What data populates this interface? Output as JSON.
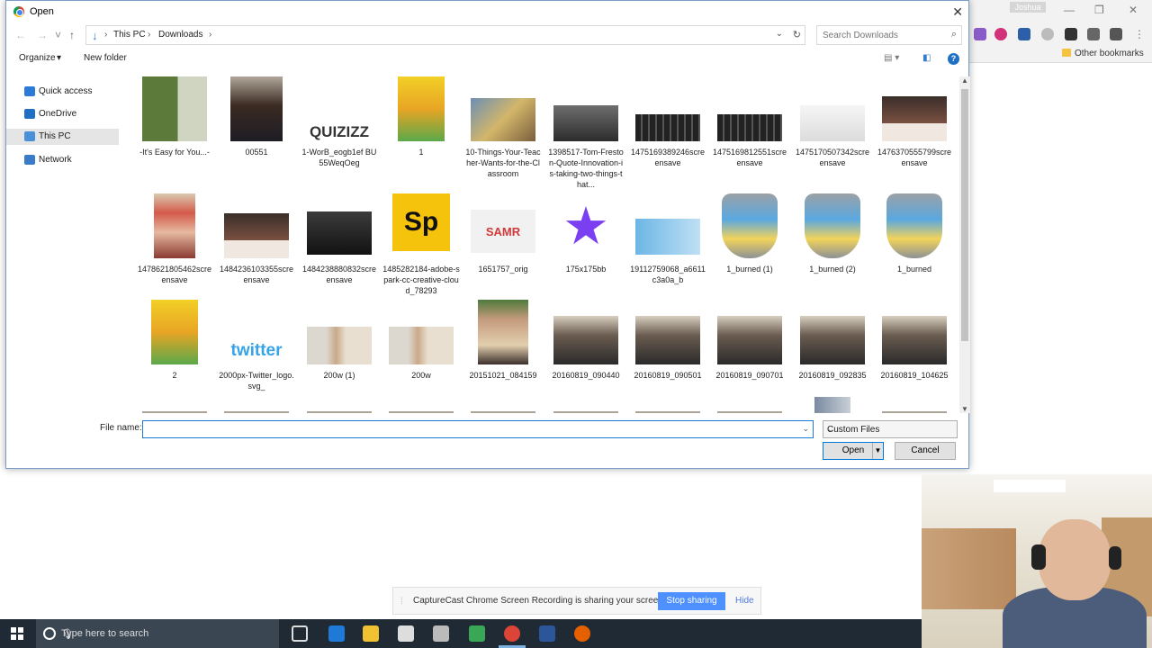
{
  "dialog": {
    "title": "Open",
    "close_glyph": "✕",
    "breadcrumbs": [
      "This PC",
      "Downloads"
    ],
    "search_placeholder": "Search Downloads",
    "commands": {
      "organize": "Organize",
      "organize_arrow": "▾",
      "new_folder": "New folder"
    },
    "help_glyph": "?",
    "nav": [
      {
        "label": "Quick access",
        "icon": "star-icon",
        "color": "#2d7ad6"
      },
      {
        "label": "OneDrive",
        "icon": "cloud-icon",
        "color": "#1f6fc5"
      },
      {
        "label": "This PC",
        "icon": "computer-icon",
        "color": "#4a90d9",
        "selected": true
      },
      {
        "label": "Network",
        "icon": "network-icon",
        "color": "#3a7bc8"
      }
    ],
    "files": [
      {
        "name": "-It's Easy for You...-",
        "thumb": "green-slide"
      },
      {
        "name": "00551",
        "thumb": "portrait"
      },
      {
        "name": "1-WorB_eogb1ef BU55WeqOeg",
        "thumb": "quizizz",
        "thumb_text": "QUIZIZZ"
      },
      {
        "name": "1",
        "thumb": "tech-wars"
      },
      {
        "name": "10-Things-Your-Teacher-Wants-for-the-Classroom",
        "thumb": "classroom"
      },
      {
        "name": "1398517-Tom-Freston-Quote-Innovation-is-taking-two-things-that...",
        "thumb": "dark-photo"
      },
      {
        "name": "1475169389246screensave",
        "thumb": "keyboard"
      },
      {
        "name": "1475169812551screensave",
        "thumb": "keyboard"
      },
      {
        "name": "1475170507342screensave",
        "thumb": "web-page"
      },
      {
        "name": "1476370555799screensave",
        "thumb": "dark-web"
      },
      {
        "name": "1478621805462screensave",
        "thumb": "portrait-red"
      },
      {
        "name": "1484236103355screensave",
        "thumb": "dark-web"
      },
      {
        "name": "1484238880832screensave",
        "thumb": "video"
      },
      {
        "name": "1485282184-adobe-spark-cc-creative-cloud_78293",
        "thumb": "spark",
        "thumb_text": "Sp"
      },
      {
        "name": "1651757_orig",
        "thumb": "samr",
        "thumb_text": "SAMR"
      },
      {
        "name": "175x175bb",
        "thumb": "imovie",
        "thumb_text": "★"
      },
      {
        "name": "19112759068_a6611c3a0a_b",
        "thumb": "twitter-blue"
      },
      {
        "name": "1_burned (1)",
        "thumb": "shield"
      },
      {
        "name": "1_burned (2)",
        "thumb": "shield"
      },
      {
        "name": "1_burned",
        "thumb": "shield"
      },
      {
        "name": "2",
        "thumb": "tech-wars"
      },
      {
        "name": "2000px-Twitter_logo.svg_",
        "thumb": "twitter-text",
        "thumb_text": "twitter"
      },
      {
        "name": "200w (1)",
        "thumb": "blonde"
      },
      {
        "name": "200w",
        "thumb": "blonde"
      },
      {
        "name": "20151021_084159",
        "thumb": "portrait-man"
      },
      {
        "name": "20160819_090440",
        "thumb": "class-photo"
      },
      {
        "name": "20160819_090501",
        "thumb": "class-photo"
      },
      {
        "name": "20160819_090701",
        "thumb": "class-photo"
      },
      {
        "name": "20160819_092835",
        "thumb": "class-photo"
      },
      {
        "name": "20160819_104625",
        "thumb": "class-photo"
      }
    ],
    "file_name_label": "File name:",
    "file_name_value": "",
    "file_type": "Custom Files",
    "open_label": "Open",
    "cancel_label": "Cancel"
  },
  "chrome": {
    "user": "Joshua",
    "bookmark": "Other bookmarks"
  },
  "share_bar": {
    "message": "CaptureCast Chrome Screen Recording is sharing your screen.",
    "stop_label": "Stop sharing",
    "hide_label": "Hide"
  },
  "taskbar": {
    "search_placeholder": "Type here to search"
  }
}
